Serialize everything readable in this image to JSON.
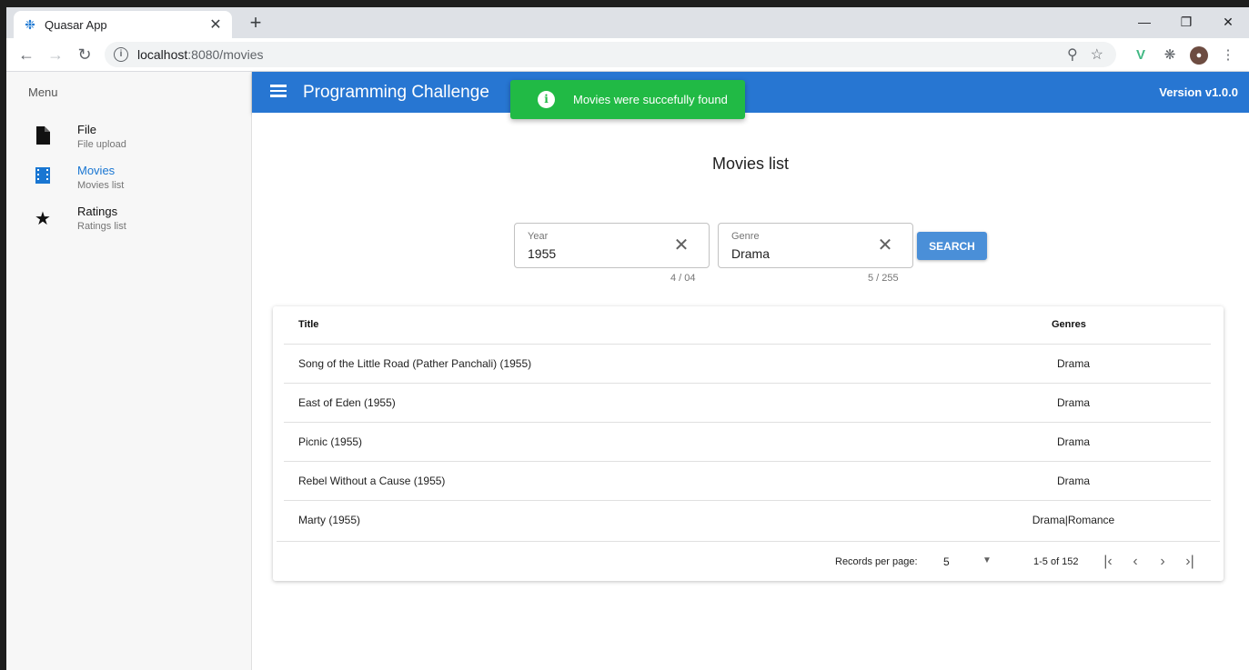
{
  "browser": {
    "tab_title": "Quasar App",
    "url_host": "localhost",
    "url_rest": ":8080/movies"
  },
  "drawer": {
    "header": "Menu",
    "items": [
      {
        "label": "File",
        "caption": "File upload",
        "icon": "file-icon"
      },
      {
        "label": "Movies",
        "caption": "Movies list",
        "icon": "film-icon",
        "active": true
      },
      {
        "label": "Ratings",
        "caption": "Ratings list",
        "icon": "star-icon"
      }
    ]
  },
  "header": {
    "title": "Programming Challenge",
    "version": "Version v1.0.0"
  },
  "notification": {
    "message": "Movies were succefully found",
    "color": "#21ba45"
  },
  "main": {
    "title": "Movies list",
    "filters": {
      "year": {
        "label": "Year",
        "value": "1955",
        "counter": "4 / 04"
      },
      "genre": {
        "label": "Genre",
        "value": "Drama",
        "counter": "5 / 255"
      },
      "search_label": "SEARCH"
    },
    "table": {
      "columns": [
        "Title",
        "Genres"
      ],
      "rows": [
        {
          "title": "Song of the Little Road (Pather Panchali) (1955)",
          "genres": "Drama"
        },
        {
          "title": "East of Eden (1955)",
          "genres": "Drama"
        },
        {
          "title": "Picnic (1955)",
          "genres": "Drama"
        },
        {
          "title": "Rebel Without a Cause (1955)",
          "genres": "Drama"
        },
        {
          "title": "Marty (1955)",
          "genres": "Drama|Romance"
        }
      ],
      "pagination": {
        "records_per_page_label": "Records per page:",
        "records_per_page": "5",
        "range": "1-5 of 152"
      }
    }
  },
  "colors": {
    "primary": "#2776d2",
    "button": "#4a8fd8"
  }
}
